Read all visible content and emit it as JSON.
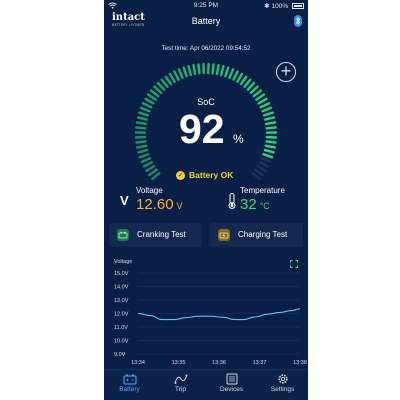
{
  "status_bar": {
    "time": "9:25 PM",
    "battery_percent": "100%",
    "icons": [
      "wifi-icon",
      "bluetooth-icon",
      "battery-icon"
    ]
  },
  "header": {
    "brand": "intact",
    "brand_sub": "BATTERY • POWER",
    "title": "Battery",
    "icon": "bluetooth-icon"
  },
  "test_time": "Test time: Apr 06/2022 09:54:52",
  "add_icon": "plus-circle-icon",
  "gauge": {
    "label": "SoC",
    "value": "92",
    "unit": "%",
    "level": 0.92,
    "color": "#2be07f"
  },
  "battery_status": {
    "text": "Battery OK",
    "icon": "check-circle-icon",
    "color": "#f3d23b"
  },
  "metrics": {
    "voltage": {
      "label": "Voltage",
      "value": "12.60",
      "unit": "V",
      "icon": "voltage-icon",
      "color": "#ffae2a"
    },
    "temperature": {
      "label": "Temperature",
      "value": "32",
      "unit": "°C",
      "icon": "thermometer-icon",
      "color": "#3de07a"
    }
  },
  "actions": [
    {
      "label": "Cranking Test",
      "icon": "cranking-test-icon",
      "color": "#2bb86b"
    },
    {
      "label": "Charging Test",
      "icon": "charging-test-icon",
      "color": "#e8b32a"
    }
  ],
  "chart_data": {
    "type": "line",
    "title": "Voltage",
    "x": [
      "13:34",
      "13:35",
      "13:36",
      "13:37",
      "13:38"
    ],
    "yticks": [
      "15.0V",
      "14.0V",
      "13.0V",
      "12.0V",
      "11.0V",
      "10.0V",
      "9.0V"
    ],
    "ylim": [
      9.0,
      15.0
    ],
    "series": [
      {
        "values": [
          [
            0.0,
            12.0
          ],
          [
            0.3,
            11.85
          ],
          [
            0.6,
            11.55
          ],
          [
            0.9,
            11.55
          ],
          [
            1.2,
            11.7
          ],
          [
            1.5,
            11.8
          ],
          [
            1.8,
            11.8
          ],
          [
            2.1,
            11.72
          ],
          [
            2.4,
            11.55
          ],
          [
            2.6,
            11.55
          ],
          [
            2.9,
            11.75
          ],
          [
            3.2,
            11.95
          ],
          [
            3.5,
            12.08
          ],
          [
            3.8,
            12.22
          ],
          [
            4.0,
            12.35
          ]
        ]
      }
    ],
    "grid": true,
    "line_color": "#6cc3ea",
    "expand_icon": "expand-icon"
  },
  "nav": {
    "active": 0,
    "items": [
      {
        "label": "Battery",
        "icon": "battery-icon"
      },
      {
        "label": "Trip",
        "icon": "trip-icon"
      },
      {
        "label": "Devices",
        "icon": "devices-icon"
      },
      {
        "label": "Settings",
        "icon": "gear-icon"
      }
    ],
    "active_color": "#46a8ff"
  }
}
